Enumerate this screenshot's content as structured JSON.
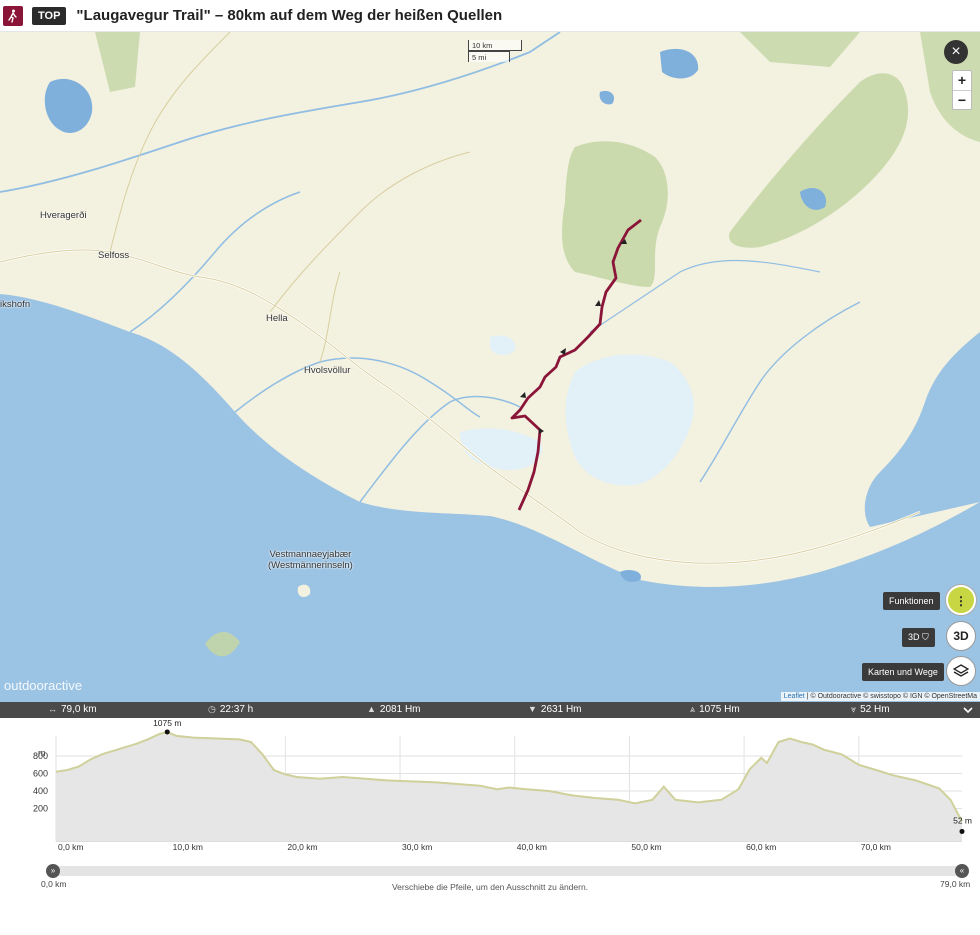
{
  "header": {
    "badge": "TOP",
    "title": "\"Laugavegur Trail\" – 80km auf dem Weg der heißen Quellen"
  },
  "map": {
    "scale_km": "10 km",
    "scale_mi": "5 mi",
    "places": [
      {
        "id": "hveragerdi",
        "name": "Hveragerði"
      },
      {
        "id": "selfoss",
        "name": "Selfoss"
      },
      {
        "id": "thorlakshofn",
        "name": "ikshofn"
      },
      {
        "id": "hella",
        "name": "Hella"
      },
      {
        "id": "hvolsvollur",
        "name": "Hvolsvöllur"
      },
      {
        "id": "vestmannaeyjar",
        "name": "Vestmannaeyjabær"
      },
      {
        "id": "vestmannaeyjar2",
        "name": "(Westmännerinseln)"
      }
    ],
    "close_label": "×",
    "zoom_in": "+",
    "zoom_out": "−",
    "functions_label": "Funktionen",
    "functions_glyph": "⋮",
    "three_d_label": "3D",
    "three_d_button": "3D",
    "layers_label": "Karten und Wege",
    "watermark": "outdooractive",
    "attribution_leaflet": "Leaflet",
    "attribution_rest": "| © Outdooractive © swisstopo © IGN © OpenStreetMa"
  },
  "stats": {
    "distance": "79,0 km",
    "duration": "22:37 h",
    "ascent": "2081 Hm",
    "descent": "2631 Hm",
    "max_alt": "1075 Hm",
    "min_alt": "52 Hm"
  },
  "elevation": {
    "y_unit": "m",
    "y_ticks": [
      "800",
      "600",
      "400",
      "200"
    ],
    "x_ticks": [
      "0,0 km",
      "10,0 km",
      "20,0 km",
      "30,0 km",
      "40,0 km",
      "50,0 km",
      "60,0 km",
      "70,0 km"
    ],
    "max_label": "1075 m",
    "min_label": "52 m",
    "range_start": "0,0 km",
    "range_end": "79,0 km",
    "hint": "Verschiebe die Pfeile, um den Ausschnitt zu ändern.",
    "profile": [
      [
        0,
        620
      ],
      [
        1,
        640
      ],
      [
        2,
        680
      ],
      [
        3,
        760
      ],
      [
        4,
        820
      ],
      [
        5,
        860
      ],
      [
        6,
        900
      ],
      [
        7,
        940
      ],
      [
        8,
        990
      ],
      [
        9,
        1050
      ],
      [
        9.7,
        1075
      ],
      [
        10.5,
        1030
      ],
      [
        12,
        1010
      ],
      [
        14,
        1000
      ],
      [
        16,
        990
      ],
      [
        17,
        960
      ],
      [
        18,
        820
      ],
      [
        19,
        640
      ],
      [
        20,
        590
      ],
      [
        21,
        560
      ],
      [
        23,
        540
      ],
      [
        25,
        560
      ],
      [
        27,
        540
      ],
      [
        29,
        520
      ],
      [
        31,
        510
      ],
      [
        33,
        500
      ],
      [
        35,
        480
      ],
      [
        37,
        460
      ],
      [
        38.5,
        420
      ],
      [
        39.5,
        440
      ],
      [
        41,
        420
      ],
      [
        43,
        400
      ],
      [
        45,
        350
      ],
      [
        47,
        320
      ],
      [
        49,
        300
      ],
      [
        50.5,
        260
      ],
      [
        52,
        300
      ],
      [
        53,
        450
      ],
      [
        54,
        300
      ],
      [
        56,
        270
      ],
      [
        58,
        300
      ],
      [
        59.5,
        420
      ],
      [
        60.5,
        650
      ],
      [
        61.5,
        780
      ],
      [
        62,
        720
      ],
      [
        63,
        960
      ],
      [
        64,
        1000
      ],
      [
        65,
        960
      ],
      [
        66,
        930
      ],
      [
        67,
        870
      ],
      [
        68.5,
        820
      ],
      [
        70,
        700
      ],
      [
        71.5,
        640
      ],
      [
        73,
        580
      ],
      [
        75,
        520
      ],
      [
        77,
        430
      ],
      [
        78,
        300
      ],
      [
        79,
        52
      ]
    ]
  }
}
